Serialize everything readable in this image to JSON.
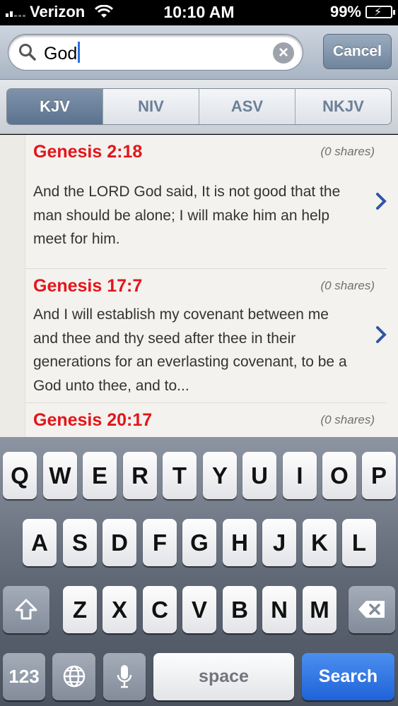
{
  "status": {
    "carrier": "Verizon",
    "time": "10:10 AM",
    "battery": "99%",
    "icons": [
      "signal-icon",
      "wifi-icon",
      "battery-icon"
    ]
  },
  "search": {
    "value": "God",
    "cancel_label": "Cancel",
    "icons": [
      "magnifier-icon",
      "clear-icon"
    ]
  },
  "translations": {
    "tabs": [
      {
        "label": "KJV",
        "selected": true
      },
      {
        "label": "NIV",
        "selected": false
      },
      {
        "label": "ASV",
        "selected": false
      },
      {
        "label": "NKJV",
        "selected": false
      }
    ]
  },
  "results": [
    {
      "reference": "Genesis 2:18",
      "shares": "(0 shares)",
      "text": "And the LORD God said, It is not good that the man should be alone; I will make him an help meet for him."
    },
    {
      "reference": "Genesis 17:7",
      "shares": "(0 shares)",
      "text": "And I will establish my covenant between me and thee and thy seed after thee in their generations for an everlasting covenant, to be a God unto thee, and to..."
    },
    {
      "reference": "Genesis 20:17",
      "shares": "(0 shares)",
      "text": ""
    }
  ],
  "keyboard": {
    "row1": [
      "Q",
      "W",
      "E",
      "R",
      "T",
      "Y",
      "U",
      "I",
      "O",
      "P"
    ],
    "row2": [
      "A",
      "S",
      "D",
      "F",
      "G",
      "H",
      "J",
      "K",
      "L"
    ],
    "row3": [
      "Z",
      "X",
      "C",
      "V",
      "B",
      "N",
      "M"
    ],
    "numbers_label": "123",
    "space_label": "space",
    "search_label": "Search",
    "icons": [
      "shift-icon",
      "backspace-icon",
      "globe-icon",
      "microphone-icon"
    ]
  },
  "colors": {
    "reference_red": "#e3151b",
    "selected_tab": "#5b7290",
    "search_key_blue": "#1f63d8"
  }
}
